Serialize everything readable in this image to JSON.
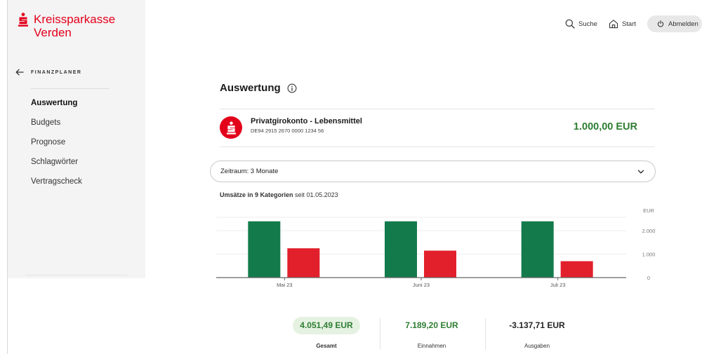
{
  "brand": {
    "name_line1": "Kreissparkasse",
    "name_line2": "Verden",
    "color": "#e3001b"
  },
  "topbar": {
    "search_label": "Suche",
    "start_label": "Start",
    "logout_label": "Abmelden"
  },
  "sidebar": {
    "back_label": "FINANZPLANER",
    "items": [
      {
        "label": "Auswertung",
        "active": true
      },
      {
        "label": "Budgets"
      },
      {
        "label": "Prognose"
      },
      {
        "label": "Schlagwörter"
      },
      {
        "label": "Vertragscheck"
      }
    ]
  },
  "main": {
    "title": "Auswertung",
    "account": {
      "name": "Privatgirokonto - Lebensmittel",
      "iban": "DE94 2915 2670 0000 1234 56",
      "balance": "1.000,00 EUR"
    },
    "period": {
      "label": "Zeitraum:",
      "value": "3 Monate"
    },
    "chart_heading": {
      "prefix": "Umsätze in 9 Kategorien",
      "suffix": "seit 01.05.2023"
    },
    "kpis": [
      {
        "value": "4.051,49 EUR",
        "label": "Gesamt",
        "color": "#2e7d32",
        "selected": true
      },
      {
        "value": "7.189,20 EUR",
        "label": "Einnahmen",
        "color": "#2e7d32"
      },
      {
        "value": "-3.137,71 EUR",
        "label": "Ausgaben",
        "color": "#222222"
      }
    ]
  },
  "chart_data": {
    "type": "bar",
    "categories": [
      "Mai 23",
      "Juni 23",
      "Juli 23"
    ],
    "series": [
      {
        "values": [
          2400,
          2400,
          2400
        ],
        "color": "#137a4b"
      },
      {
        "values": [
          1250,
          1150,
          700
        ],
        "color": "#e2202c"
      }
    ],
    "yunit": "EUR",
    "yticks": [
      {
        "value": 2000,
        "label": "2.000"
      },
      {
        "value": 1000,
        "label": "1.000"
      },
      {
        "value": 0,
        "label": "0"
      }
    ],
    "ylim": [
      0,
      2900
    ],
    "grid": true
  }
}
